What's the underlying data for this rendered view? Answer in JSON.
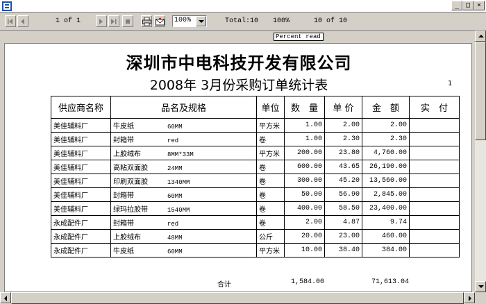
{
  "toolbar": {
    "page_indicator": "1 of 1",
    "zoom_value": "100%",
    "total_text": "Total:10",
    "percent_text": "100%",
    "record_text": "10 of 10"
  },
  "status": {
    "percent_read": "Percent read"
  },
  "report": {
    "company": "深圳市中电科技开发有限公司",
    "title": "2008年 3月份采购订单统计表",
    "page_number": "1",
    "headers": [
      "供应商名称",
      "品名及规格",
      "单位",
      "数　量",
      "单 价",
      "金　额",
      "实　付"
    ],
    "rows": [
      {
        "supplier": "美佳辅料厂",
        "name": "牛皮纸",
        "spec": "60MM",
        "unit": "平方米",
        "qty": "1.00",
        "price": "2.00",
        "amount": "2.00",
        "paid": ""
      },
      {
        "supplier": "美佳辅料厂",
        "name": "封箱带",
        "spec": "red",
        "unit": "卷",
        "qty": "1.00",
        "price": "2.30",
        "amount": "2.30",
        "paid": ""
      },
      {
        "supplier": "美佳辅料厂",
        "name": "上胶绒布",
        "spec": "8MM*33M",
        "unit": "平方米",
        "qty": "200.00",
        "price": "23.80",
        "amount": "4,760.00",
        "paid": ""
      },
      {
        "supplier": "美佳辅料厂",
        "name": "高粘双面胶",
        "spec": "24MM",
        "unit": "卷",
        "qty": "600.00",
        "price": "43.65",
        "amount": "26,190.00",
        "paid": ""
      },
      {
        "supplier": "美佳辅料厂",
        "name": "印刷双面胶",
        "spec": "1340MM",
        "unit": "卷",
        "qty": "300.00",
        "price": "45.20",
        "amount": "13,560.00",
        "paid": ""
      },
      {
        "supplier": "美佳辅料厂",
        "name": "封箱带",
        "spec": "60MM",
        "unit": "卷",
        "qty": "50.00",
        "price": "56.90",
        "amount": "2,845.00",
        "paid": ""
      },
      {
        "supplier": "美佳辅料厂",
        "name": "绿玛拉胶带",
        "spec": "1540MM",
        "unit": "卷",
        "qty": "400.00",
        "price": "58.50",
        "amount": "23,400.00",
        "paid": ""
      },
      {
        "supplier": "永成配件厂",
        "name": "封箱带",
        "spec": "red",
        "unit": "卷",
        "qty": "2.00",
        "price": "4.87",
        "amount": "9.74",
        "paid": ""
      },
      {
        "supplier": "永成配件厂",
        "name": "上胶绒布",
        "spec": "48MM",
        "unit": "公斤",
        "qty": "20.00",
        "price": "23.00",
        "amount": "460.00",
        "paid": ""
      },
      {
        "supplier": "永成配件厂",
        "name": "牛皮纸",
        "spec": "60MM",
        "unit": "平方米",
        "qty": "10.00",
        "price": "38.40",
        "amount": "384.00",
        "paid": ""
      }
    ],
    "total_label": "合计",
    "total_qty": "1,584.00",
    "total_amount": "71,613.04"
  },
  "icons": {
    "app": "report-app-icon",
    "print": "printer-icon",
    "export": "export-mail-icon"
  }
}
